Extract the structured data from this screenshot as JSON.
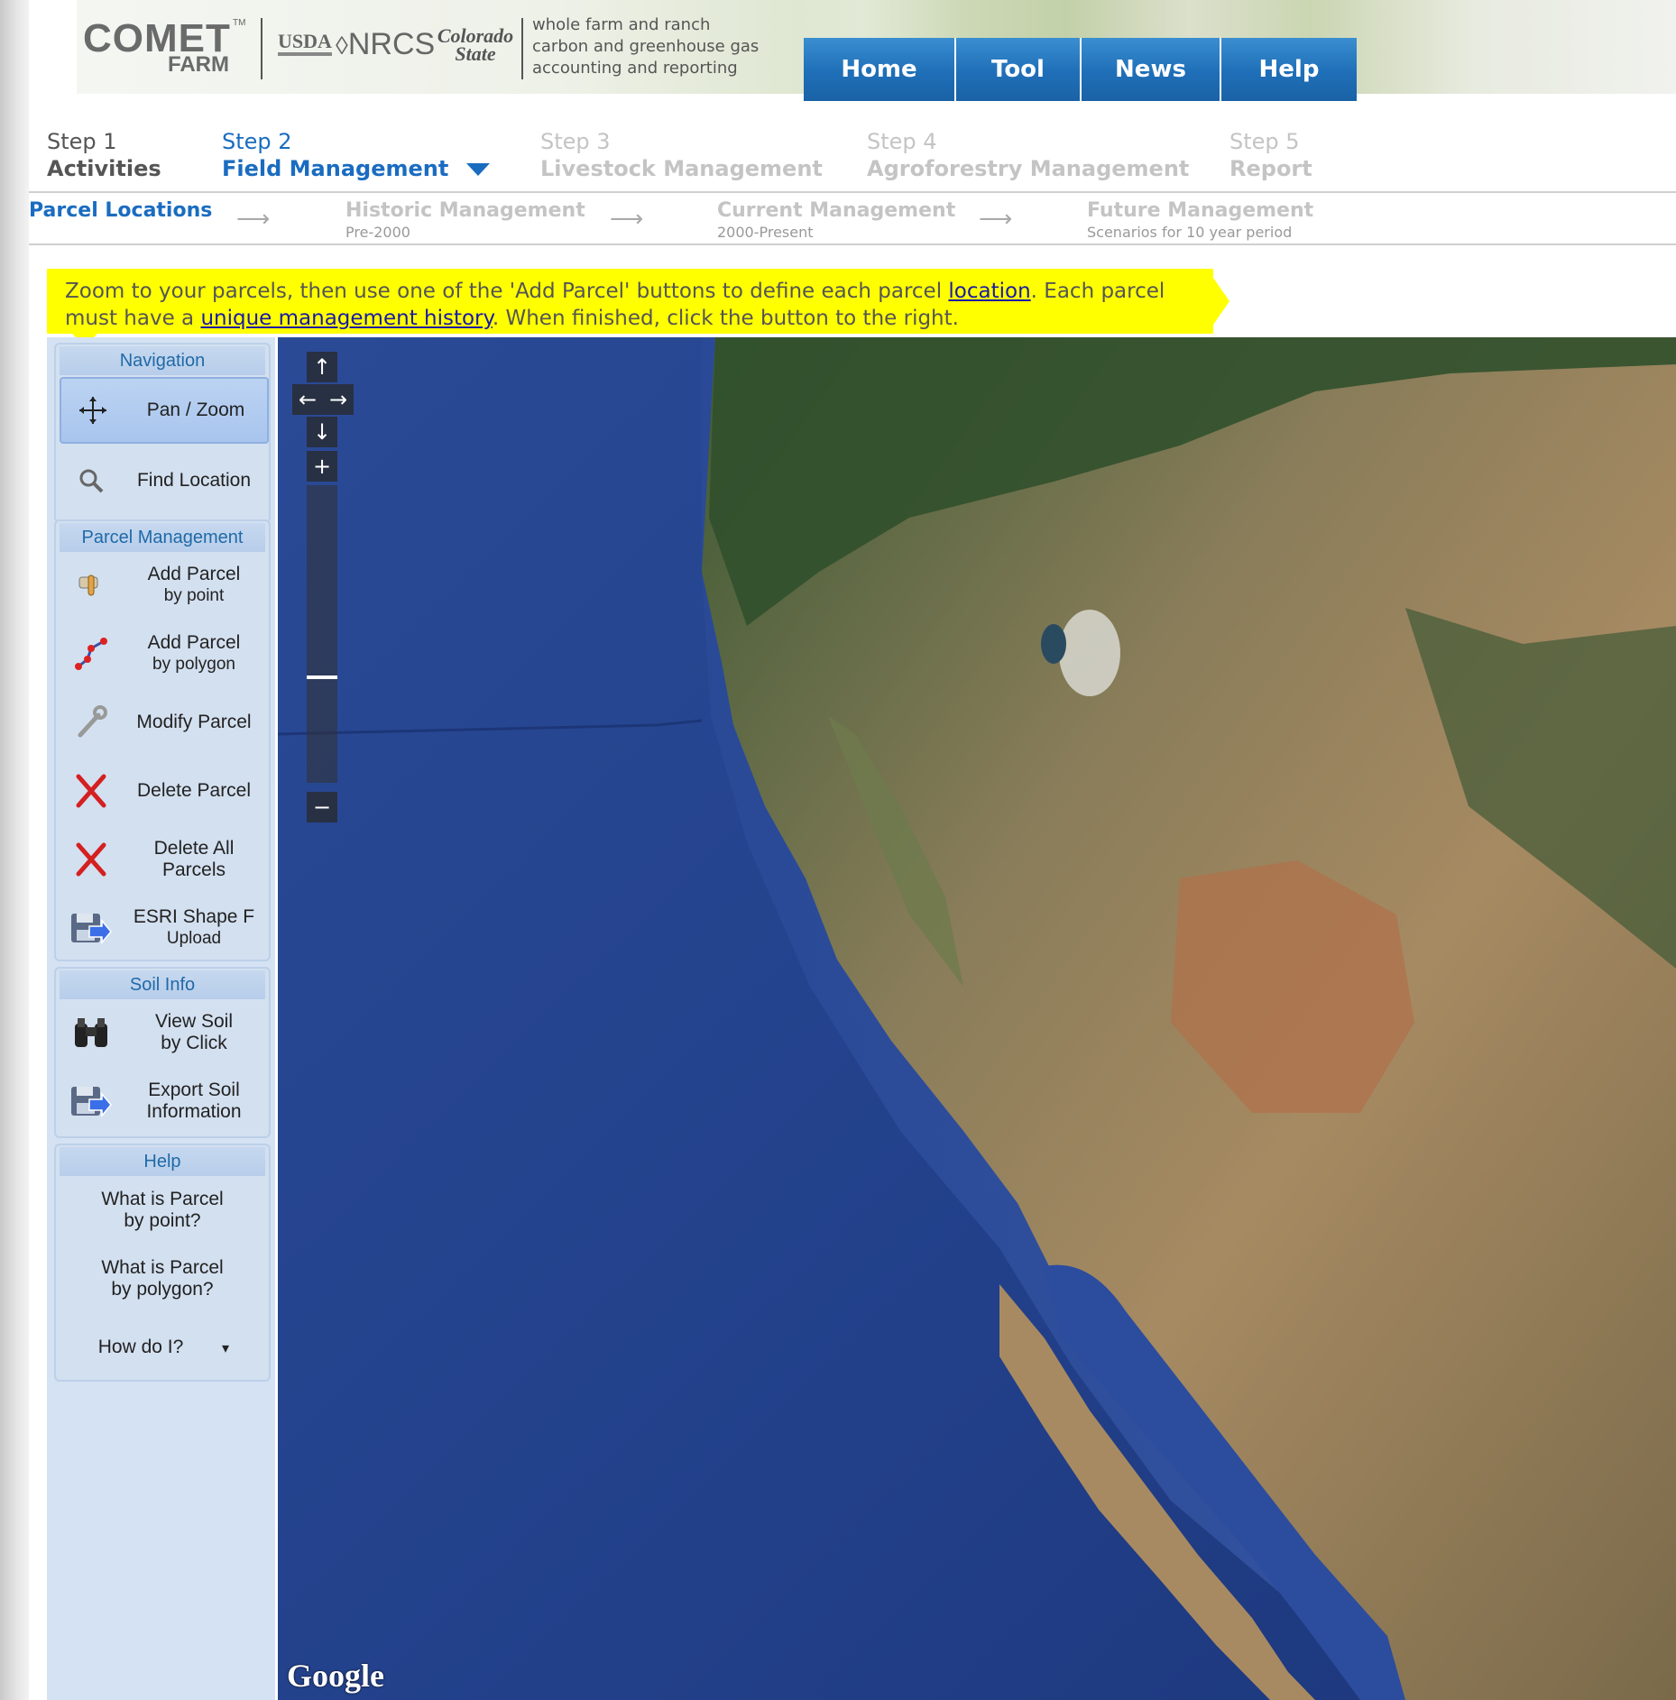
{
  "header": {
    "logo_main": "COMET",
    "logo_tm": "TM",
    "logo_sub": "FARM",
    "partners": [
      "USDA",
      "NRCS",
      "Colorado State"
    ],
    "tagline": [
      "whole farm and ranch",
      "carbon and greenhouse gas",
      "accounting and reporting"
    ],
    "nav_tabs": [
      "Home",
      "Tool",
      "News",
      "Help"
    ]
  },
  "steps": [
    {
      "num": "Step 1",
      "title": "Activities",
      "state": "done"
    },
    {
      "num": "Step 2",
      "title": "Field Management",
      "state": "active"
    },
    {
      "num": "Step 3",
      "title": "Livestock Management",
      "state": "future"
    },
    {
      "num": "Step 4",
      "title": "Agroforestry Management",
      "state": "future"
    },
    {
      "num": "Step 5",
      "title": "Report",
      "state": "future"
    }
  ],
  "substeps": [
    {
      "title": "Parcel Locations",
      "desc": "",
      "state": "active"
    },
    {
      "title": "Historic Management",
      "desc": "Pre-2000",
      "state": "future"
    },
    {
      "title": "Current Management",
      "desc": "2000-Present",
      "state": "future"
    },
    {
      "title": "Future Management",
      "desc": "Scenarios for 10 year period",
      "state": "future"
    }
  ],
  "banner": {
    "text_1": "Zoom to your parcels, then use one of the 'Add Parcel' buttons to define each parcel ",
    "link_1": "location",
    "text_2": ". Each parcel must have a ",
    "link_2": "unique management history",
    "text_3": ". When finished, click the button to the right."
  },
  "sidebar": {
    "navigation": {
      "title": "Navigation",
      "tools": [
        {
          "label": "Pan / Zoom",
          "icon": "pan-icon",
          "selected": true
        },
        {
          "label": "Find Location",
          "icon": "magnifier-icon",
          "selected": false
        }
      ]
    },
    "parcel_management": {
      "title": "Parcel Management",
      "tools": [
        {
          "label": "Add Parcel",
          "label2": "by point",
          "icon": "point-hand-icon"
        },
        {
          "label": "Add Parcel",
          "label2": "by polygon",
          "icon": "polygon-icon"
        },
        {
          "label": "Modify Parcel",
          "label2": "",
          "icon": "wrench-icon"
        },
        {
          "label": "Delete Parcel",
          "label2": "",
          "icon": "red-x-icon"
        },
        {
          "label": "Delete All",
          "label2": "Parcels",
          "icon": "red-x-icon"
        },
        {
          "label": "ESRI Shape F",
          "label2": "Upload",
          "icon": "floppy-arrow-icon"
        }
      ]
    },
    "soil_info": {
      "title": "Soil Info",
      "tools": [
        {
          "label": "View Soil",
          "label2": "by Click",
          "icon": "binoculars-icon"
        },
        {
          "label": "Export Soil",
          "label2": "Information",
          "icon": "floppy-arrow-icon"
        }
      ]
    },
    "help": {
      "title": "Help",
      "items": [
        {
          "line1": "What is Parcel",
          "line2": "by point?"
        },
        {
          "line1": "What is Parcel",
          "line2": "by polygon?"
        },
        {
          "line1": "How do I?",
          "line2": ""
        }
      ],
      "dropdown_glyph": "▾"
    }
  },
  "map": {
    "attribution": "Google",
    "controls": {
      "up": "↑",
      "left": "←",
      "right": "→",
      "down": "↓",
      "zoom_in": "+",
      "zoom_out": "−"
    },
    "zoom_level_fraction": 0.64
  },
  "colors": {
    "nav_blue": "#1f6fb8",
    "active_step": "#1a6cc0",
    "banner_yellow": "#ffff00",
    "sidebar_bg": "#d5e2f3",
    "ocean": "#23408c"
  }
}
